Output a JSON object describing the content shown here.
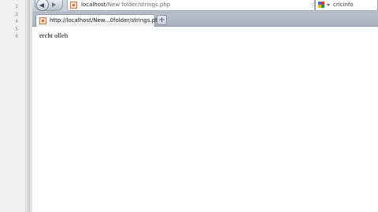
{
  "editor": {
    "line_numbers": [
      "2",
      "3",
      "4",
      "5",
      "6"
    ]
  },
  "browser": {
    "address_bar": {
      "host": "localhost",
      "path": "/New folder/strings.php"
    },
    "search": {
      "query": "cricinfo"
    },
    "tab": {
      "label": "http://localhost/New...0folder/strings.php"
    },
    "new_tab_label": "+",
    "page": {
      "text": "ercht olleh"
    }
  },
  "colors": {
    "favicon": "#d4703a",
    "chrome": "#c4cad4"
  },
  "icons": {
    "back": "back-arrow-icon",
    "forward": "forward-arrow-icon",
    "bookmark": "star-icon",
    "feed": "feed-icon",
    "reload": "reload-icon",
    "search_engine": "google-icon"
  }
}
